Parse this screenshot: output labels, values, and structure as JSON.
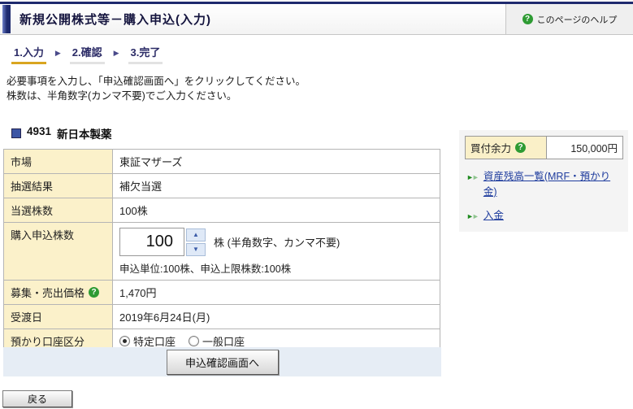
{
  "header": {
    "title": "新規公開株式等－購入申込(入力)",
    "help_label": "このページのヘルプ"
  },
  "steps": [
    {
      "label": "1.入力",
      "active": true
    },
    {
      "label": "2.確認",
      "active": false
    },
    {
      "label": "3.完了",
      "active": false
    }
  ],
  "instructions": {
    "line1": "必要事項を入力し、「申込確認画面へ」をクリックしてください。",
    "line2": "株数は、半角数字(カンマ不要)でご入力ください。"
  },
  "stock": {
    "code": "4931",
    "name": "新日本製薬"
  },
  "form": {
    "market_label": "市場",
    "market_value": "東証マザーズ",
    "lottery_label": "抽選結果",
    "lottery_value": "補欠当選",
    "won_label": "当選株数",
    "won_value": "100株",
    "qty_label": "購入申込株数",
    "qty_value": "100",
    "qty_unit": "株 (半角数字、カンマ不要)",
    "qty_note": "申込単位:100株、申込上限株数:100株",
    "price_label": "募集・売出価格",
    "price_value": "1,470円",
    "settlement_label": "受渡日",
    "settlement_value": "2019年6月24日(月)",
    "account_label": "預かり口座区分",
    "account_options": [
      {
        "label": "特定口座",
        "selected": true
      },
      {
        "label": "一般口座",
        "selected": false
      }
    ]
  },
  "sidebar": {
    "power_label": "買付余力",
    "power_value": "150,000円",
    "links": [
      {
        "label": "資産残高一覧(MRF・預かり金)"
      },
      {
        "label": "入金"
      }
    ]
  },
  "buttons": {
    "confirm": "申込確認画面へ",
    "back": "戻る"
  },
  "icons": {
    "help_q": "?",
    "step_arrow": "▶",
    "link_arrow": "►",
    "up_arrow": "▲",
    "down_arrow": "▼"
  },
  "colors": {
    "navy": "#1e2a6e",
    "active_step_underline": "#d9a520",
    "label_cell_bg": "#fbf1ca",
    "help_icon_green": "#2e9b33",
    "link_blue": "#1f3d9e",
    "band_blue": "#e6edf5"
  }
}
